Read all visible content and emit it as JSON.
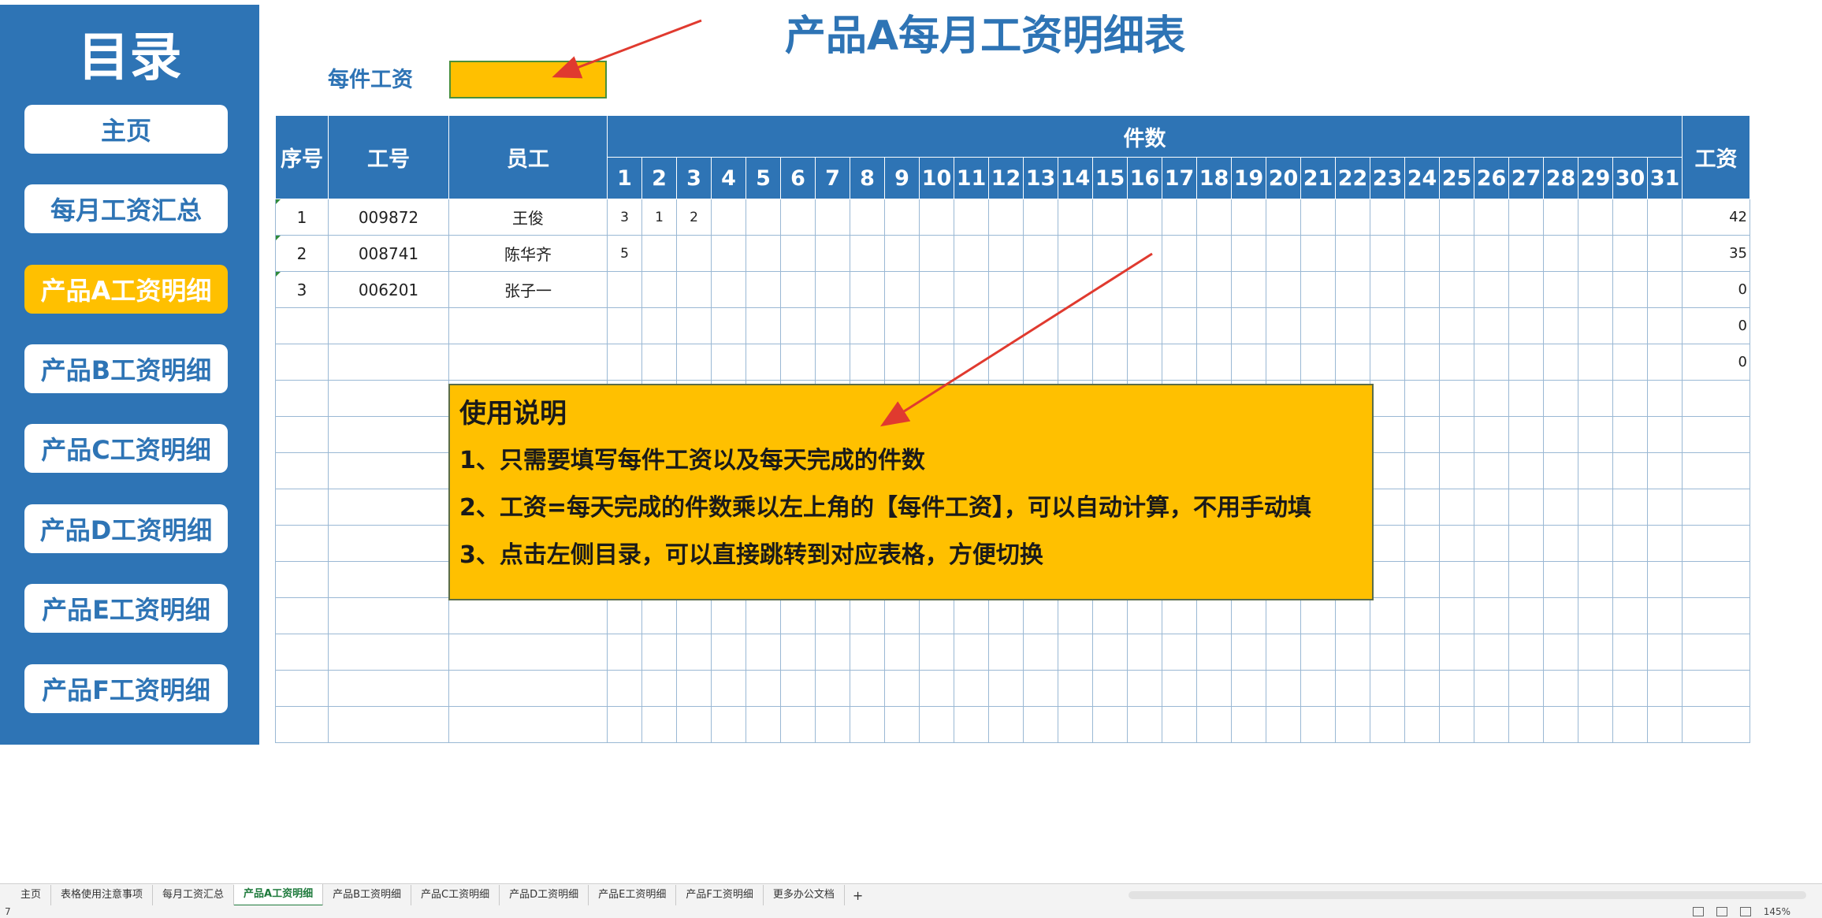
{
  "sidebar": {
    "title": "目录",
    "items": [
      {
        "label": "主页",
        "active": false
      },
      {
        "label": "每月工资汇总",
        "active": false
      },
      {
        "label": "产品A工资明细",
        "active": true
      },
      {
        "label": "产品B工资明细",
        "active": false
      },
      {
        "label": "产品C工资明细",
        "active": false
      },
      {
        "label": "产品D工资明细",
        "active": false
      },
      {
        "label": "产品E工资明细",
        "active": false
      },
      {
        "label": "产品F工资明细",
        "active": false
      }
    ]
  },
  "header": {
    "title": "产品A每月工资明细表",
    "rate_label": "每件工资",
    "rate_value": ""
  },
  "table": {
    "col_seq": "序号",
    "col_id": "工号",
    "col_name": "员工",
    "col_pieces": "件数",
    "col_wage": "工资",
    "days": [
      "1",
      "2",
      "3",
      "4",
      "5",
      "6",
      "7",
      "8",
      "9",
      "10",
      "11",
      "12",
      "13",
      "14",
      "15",
      "16",
      "17",
      "18",
      "19",
      "20",
      "21",
      "22",
      "23",
      "24",
      "25",
      "26",
      "27",
      "28",
      "29",
      "30",
      "31"
    ],
    "rows": [
      {
        "seq": "1",
        "id": "009872",
        "name": "王俊",
        "pieces": [
          "3",
          "1",
          "2"
        ],
        "wage": "42"
      },
      {
        "seq": "2",
        "id": "008741",
        "name": "陈华齐",
        "pieces": [
          "5"
        ],
        "wage": "35"
      },
      {
        "seq": "3",
        "id": "006201",
        "name": "张子一",
        "pieces": [],
        "wage": "0"
      },
      {
        "seq": "",
        "id": "",
        "name": "",
        "pieces": [],
        "wage": "0"
      },
      {
        "seq": "",
        "id": "",
        "name": "",
        "pieces": [],
        "wage": "0"
      },
      {
        "seq": "",
        "id": "",
        "name": "",
        "pieces": [],
        "wage": ""
      },
      {
        "seq": "",
        "id": "",
        "name": "",
        "pieces": [],
        "wage": ""
      },
      {
        "seq": "",
        "id": "",
        "name": "",
        "pieces": [],
        "wage": ""
      },
      {
        "seq": "",
        "id": "",
        "name": "",
        "pieces": [],
        "wage": ""
      },
      {
        "seq": "",
        "id": "",
        "name": "",
        "pieces": [],
        "wage": ""
      },
      {
        "seq": "",
        "id": "",
        "name": "",
        "pieces": [],
        "wage": ""
      },
      {
        "seq": "",
        "id": "",
        "name": "",
        "pieces": [],
        "wage": ""
      },
      {
        "seq": "",
        "id": "",
        "name": "",
        "pieces": [],
        "wage": ""
      },
      {
        "seq": "",
        "id": "",
        "name": "",
        "pieces": [],
        "wage": ""
      },
      {
        "seq": "",
        "id": "",
        "name": "",
        "pieces": [],
        "wage": ""
      }
    ]
  },
  "instructions": {
    "title": "使用说明",
    "lines": [
      "1、只需要填写每件工资以及每天完成的件数",
      "2、工资=每天完成的件数乘以左上角的【每件工资】，可以自动计算，不用手动填",
      "3、点击左侧目录，可以直接跳转到对应表格，方便切换"
    ]
  },
  "colors": {
    "primary": "#2e74b5",
    "accent": "#ffc000",
    "arrow": "#e03a2f"
  },
  "tabs": [
    {
      "label": "主页",
      "active": false
    },
    {
      "label": "表格使用注意事项",
      "active": false
    },
    {
      "label": "每月工资汇总",
      "active": false
    },
    {
      "label": "产品A工资明细",
      "active": true
    },
    {
      "label": "产品B工资明细",
      "active": false
    },
    {
      "label": "产品C工资明细",
      "active": false
    },
    {
      "label": "产品D工资明细",
      "active": false
    },
    {
      "label": "产品E工资明细",
      "active": false
    },
    {
      "label": "产品F工资明细",
      "active": false
    },
    {
      "label": "更多办公文档",
      "active": false
    }
  ],
  "tab_add_label": "+",
  "status": {
    "left": "7",
    "zoom": "145%"
  }
}
